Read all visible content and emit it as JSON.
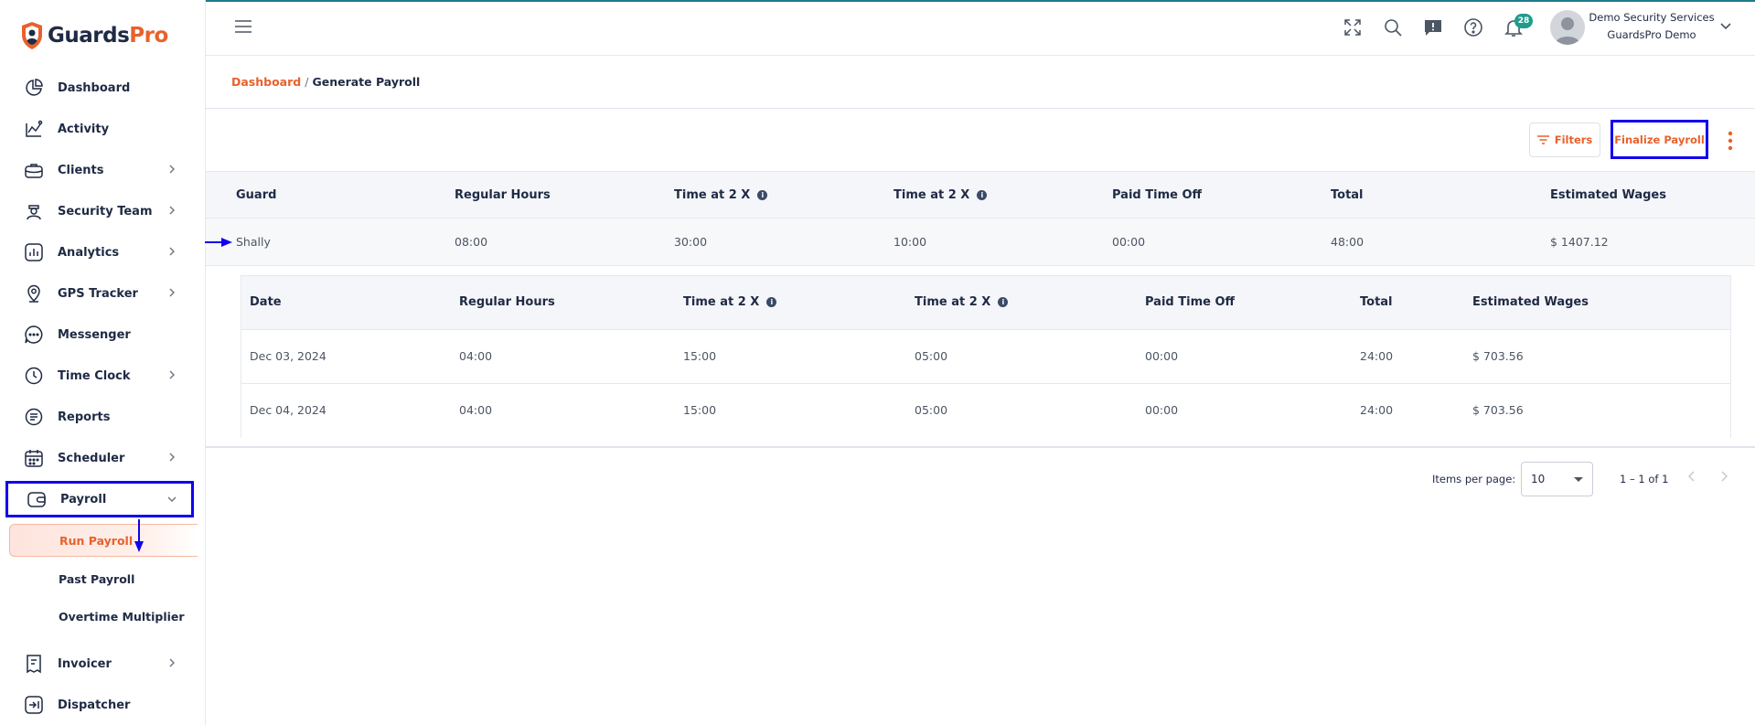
{
  "brand": {
    "name_part1": "Guards",
    "name_part2": "Pro"
  },
  "sidebar": {
    "items": [
      {
        "label": "Dashboard",
        "icon": "dashboard-icon",
        "has_children": false
      },
      {
        "label": "Activity",
        "icon": "activity-icon",
        "has_children": false
      },
      {
        "label": "Clients",
        "icon": "briefcase-icon",
        "has_children": true
      },
      {
        "label": "Security Team",
        "icon": "guard-icon",
        "has_children": true
      },
      {
        "label": "Analytics",
        "icon": "analytics-icon",
        "has_children": true
      },
      {
        "label": "GPS Tracker",
        "icon": "location-pin-icon",
        "has_children": true
      },
      {
        "label": "Messenger",
        "icon": "chat-bubble-icon",
        "has_children": false
      },
      {
        "label": "Time Clock",
        "icon": "clock-icon",
        "has_children": true
      },
      {
        "label": "Reports",
        "icon": "report-icon",
        "has_children": false
      },
      {
        "label": "Scheduler",
        "icon": "calendar-icon",
        "has_children": true
      },
      {
        "label": "Payroll",
        "icon": "wallet-icon",
        "has_children": true,
        "expanded": true
      },
      {
        "label": "Invoicer",
        "icon": "invoice-icon",
        "has_children": true
      },
      {
        "label": "Dispatcher",
        "icon": "dispatch-icon",
        "has_children": false
      }
    ],
    "payroll_sub": [
      {
        "label": "Run Payroll",
        "active": true
      },
      {
        "label": "Past Payroll",
        "active": false
      },
      {
        "label": "Overtime Multiplier",
        "active": false
      }
    ]
  },
  "header": {
    "notification_count": "28",
    "user_name": "Demo Security Services",
    "user_org": "GuardsPro Demo"
  },
  "breadcrumb": {
    "home": "Dashboard",
    "separator": "/",
    "current": "Generate Payroll"
  },
  "actions": {
    "filters_label": "Filters",
    "finalize_label": "Finalize Payroll"
  },
  "main_table": {
    "columns": [
      "Guard",
      "Regular Hours",
      "Time at 2 X",
      "Time at 2 X",
      "Paid Time Off",
      "Total",
      "Estimated Wages"
    ],
    "rows": [
      [
        "Shally",
        "08:00",
        "30:00",
        "10:00",
        "00:00",
        "48:00",
        "$ 1407.12"
      ]
    ]
  },
  "detail_table": {
    "columns": [
      "Date",
      "Regular Hours",
      "Time at 2 X",
      "Time at 2 X",
      "Paid Time Off",
      "Total",
      "Estimated Wages"
    ],
    "rows": [
      [
        "Dec 03, 2024",
        "04:00",
        "15:00",
        "05:00",
        "00:00",
        "24:00",
        "$ 703.56"
      ],
      [
        "Dec 04, 2024",
        "04:00",
        "15:00",
        "05:00",
        "00:00",
        "24:00",
        "$ 703.56"
      ]
    ]
  },
  "paginator": {
    "items_per_page_label": "Items per page:",
    "page_size": "10",
    "range": "1 – 1 of 1"
  },
  "colors": {
    "accent": "#e8612c",
    "navy": "#1f2a44",
    "badge": "#1f9d8b",
    "annotation": "#1100ee"
  }
}
